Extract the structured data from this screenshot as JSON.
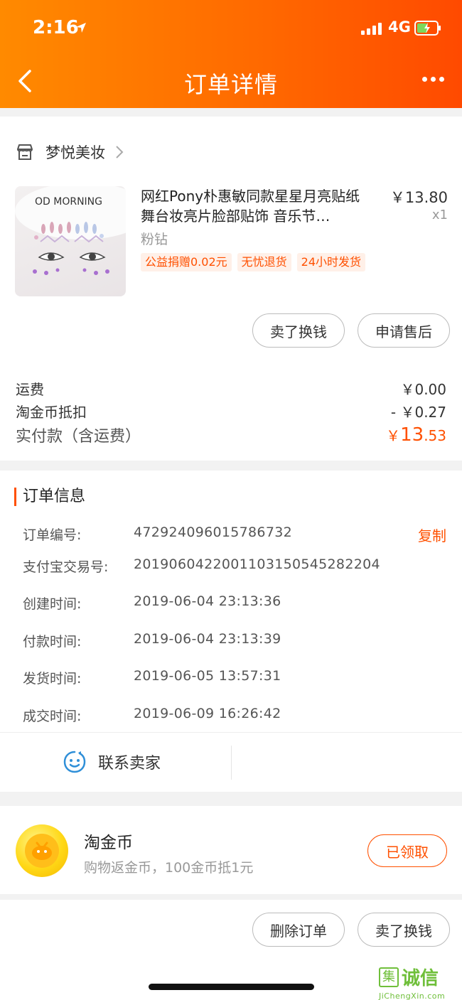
{
  "status_bar": {
    "time": "2:16",
    "network": "4G"
  },
  "nav": {
    "title": "订单详情"
  },
  "shop": {
    "name": "梦悦美妆"
  },
  "product": {
    "title": "网红Pony朴惠敏同款星星月亮贴纸 舞台妆亮片脸部贴饰 音乐节…",
    "price": "￥13.80",
    "qty": "x1",
    "spec": "粉钻",
    "tags": [
      "公益捐赠0.02元",
      "无忧退货",
      "24小时发货"
    ],
    "image_caption": "OD MORNING"
  },
  "item_actions": {
    "sell_label": "卖了换钱",
    "aftersale_label": "申请售后"
  },
  "fees": {
    "shipping_label": "运费",
    "shipping_value": "￥0.00",
    "coin_label": "淘金币抵扣",
    "coin_value": "- ￥0.27",
    "total_label": "实付款（含运费）",
    "total_currency": "￥",
    "total_int": "13",
    "total_dec": ".53"
  },
  "order_info": {
    "title": "订单信息",
    "copy_label": "复制",
    "rows": [
      {
        "label": "订单编号:",
        "value": "472924096015786732"
      },
      {
        "label": "支付宝交易号:",
        "value": "2019060422001103150545282204"
      },
      {
        "label": "创建时间:",
        "value": "2019-06-04 23:13:36"
      },
      {
        "label": "付款时间:",
        "value": "2019-06-04 23:13:39"
      },
      {
        "label": "发货时间:",
        "value": "2019-06-05 13:57:31"
      },
      {
        "label": "成交时间:",
        "value": "2019-06-09 16:26:42"
      }
    ]
  },
  "contact": {
    "label": "联系卖家"
  },
  "coins": {
    "title": "淘金币",
    "subtitle": "购物返金币，100金币抵1元",
    "button_label": "已领取"
  },
  "bottom_actions": {
    "delete_label": "删除订单",
    "sell_label": "卖了换钱"
  },
  "watermark": {
    "logo_char": "集",
    "text": "诚信",
    "url": "JiChengXin.com"
  },
  "colors": {
    "accent": "#ff5000",
    "header_start": "#ff8a00",
    "header_end": "#ff4a00"
  }
}
